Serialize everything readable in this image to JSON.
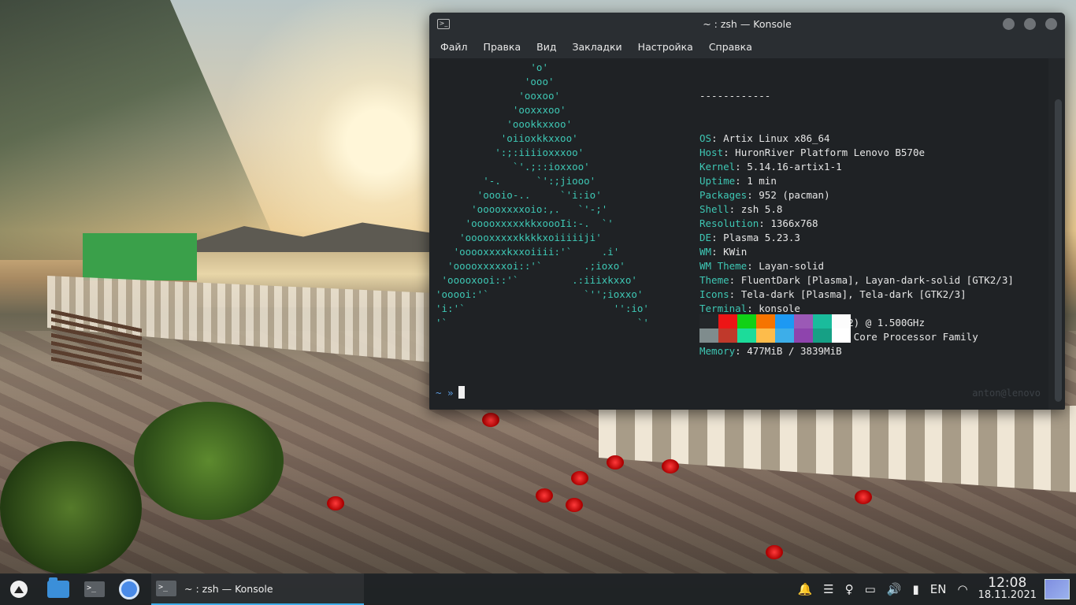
{
  "window": {
    "title": "~ : zsh — Konsole",
    "menu": [
      "Файл",
      "Правка",
      "Вид",
      "Закладки",
      "Настройка",
      "Справка"
    ]
  },
  "terminal": {
    "ascii_art": "                'o'\n               'ooo'\n              'ooxoo'\n             'ooxxxoo'\n            'oookkxxoo'\n           'oiioxkkxxoo'\n          ':;:iiiioxxxoo'\n             `'.;::ioxxoo'\n        '-.      `':;jiooo'\n       'oooio-..     `'i:io'\n      'ooooxxxxoio:,.   `'-;'\n     'ooooxxxxxkkxoooIi:-.  `'\n    'ooooxxxxxkkkkxoiiiiiji'\n   'ooooxxxxkxxoiiii:'`     .i'\n  'ooooxxxxxoi::'`       .;ioxo'\n 'ooooxooi::'`         .:iiixkxxo'\n'ooooi:'`                `'';ioxxo'\n'i:'`                         '':io'\n'`                                `'",
    "separator": "------------",
    "info": [
      {
        "key": "OS",
        "value": "Artix Linux x86_64"
      },
      {
        "key": "Host",
        "value": "HuronRiver Platform Lenovo B570e"
      },
      {
        "key": "Kernel",
        "value": "5.14.16-artix1-1"
      },
      {
        "key": "Uptime",
        "value": "1 min"
      },
      {
        "key": "Packages",
        "value": "952 (pacman)"
      },
      {
        "key": "Shell",
        "value": "zsh 5.8"
      },
      {
        "key": "Resolution",
        "value": "1366x768"
      },
      {
        "key": "DE",
        "value": "Plasma 5.23.3"
      },
      {
        "key": "WM",
        "value": "KWin"
      },
      {
        "key": "WM Theme",
        "value": "Layan-solid"
      },
      {
        "key": "Theme",
        "value": "FluentDark [Plasma], Layan-dark-solid [GTK2/3]"
      },
      {
        "key": "Icons",
        "value": "Tela-dark [Plasma], Tela-dark [GTK2/3]"
      },
      {
        "key": "Terminal",
        "value": "konsole"
      },
      {
        "key": "CPU",
        "value": "Intel Celeron B800 (2) @ 1.500GHz"
      },
      {
        "key": "GPU",
        "value": "Intel 2nd Generation Core Processor Family"
      },
      {
        "key": "Memory",
        "value": "477MiB / 3839MiB"
      }
    ],
    "palette_top": [
      "#232629",
      "#ed1515",
      "#11d116",
      "#f67400",
      "#1d99f3",
      "#9b59b6",
      "#1abc9c",
      "#fcfcfc"
    ],
    "palette_bottom": [
      "#7f8c8d",
      "#c0392b",
      "#1cdc9a",
      "#fdbc4b",
      "#3daee9",
      "#8e44ad",
      "#16a085",
      "#ffffff"
    ],
    "prompt": "~ »",
    "rprompt": "anton@lenovo"
  },
  "taskbar": {
    "task_label": "~ : zsh — Konsole",
    "language": "EN",
    "time": "12:08",
    "date": "18.11.2021"
  }
}
